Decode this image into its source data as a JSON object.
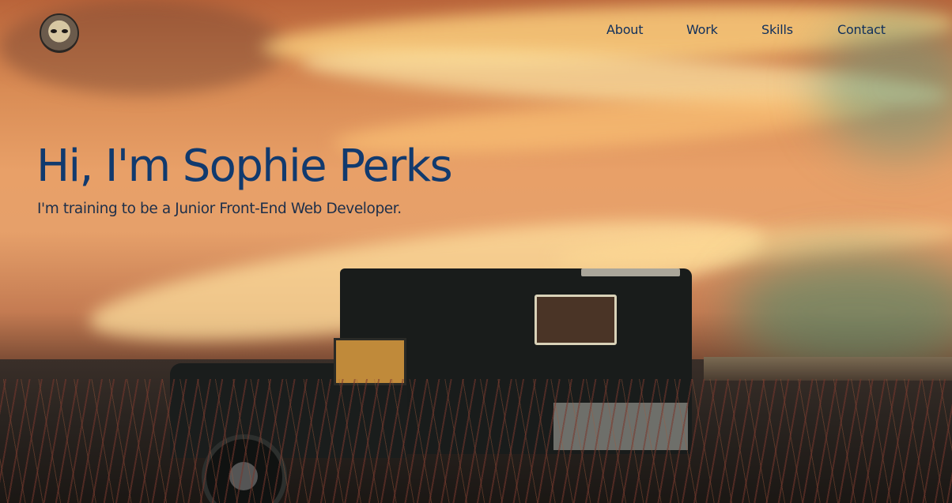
{
  "header": {
    "avatar_icon": "cat-face-avatar-icon",
    "nav": [
      {
        "label": "About"
      },
      {
        "label": "Work"
      },
      {
        "label": "Skills"
      },
      {
        "label": "Contact"
      }
    ]
  },
  "hero": {
    "title": "Hi, I'm Sophie Perks",
    "subtitle": "I'm training to be a Junior Front-End Web Developer.",
    "background_image": "sunset-camper-truck-in-field"
  },
  "colors": {
    "title": "#113a6e",
    "nav_link": "#0f2f5c",
    "subtitle": "#1d2f4a"
  }
}
